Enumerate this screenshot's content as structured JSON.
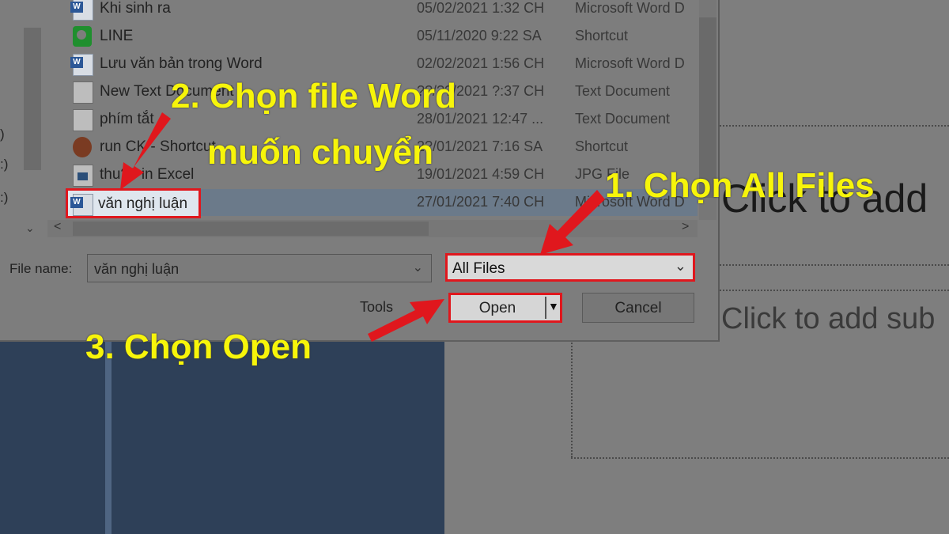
{
  "nav_pane": {
    "items": [
      ")",
      ":)",
      ":)"
    ]
  },
  "files": [
    {
      "name": "Khi sinh ra",
      "date": "05/02/2021 1:32 CH",
      "type": "Microsoft Word D",
      "icon": "word-doc-icon"
    },
    {
      "name": "LINE",
      "date": "05/11/2020 9:22 SA",
      "type": "Shortcut",
      "icon": "line-app-icon"
    },
    {
      "name": "Lưu văn bản trong Word",
      "date": "02/02/2021 1:56 CH",
      "type": "Microsoft Word D",
      "icon": "word-doc-icon"
    },
    {
      "name": "New Text Document",
      "date": "??/??/2021 ?:37 CH",
      "type": "Text Document",
      "icon": "text-doc-icon"
    },
    {
      "name": "phím tắt",
      "date": "28/01/2021 12:47 ...",
      "type": "Text Document",
      "icon": "text-doc-icon"
    },
    {
      "name": "run CK - Shortcut",
      "date": "2?/01/2021 7:16 SA",
      "type": "Shortcut",
      "icon": "shortcut-game-icon"
    },
    {
      "name": "thu?? in Excel",
      "date": "19/01/2021 4:59 CH",
      "type": "JPG File",
      "icon": "jpg-file-icon"
    },
    {
      "name": "văn nghị luận",
      "date": "27/01/2021 7:40 CH",
      "type": "Microsoft Word D",
      "icon": "word-doc-icon",
      "selected": true
    }
  ],
  "footer": {
    "file_name_label": "File name:",
    "file_name_value": "văn nghị luận",
    "file_type_value": "All Files",
    "tools_label": "Tools",
    "open_label": "Open",
    "cancel_label": "Cancel"
  },
  "background": {
    "title_placeholder": "Click to add",
    "subtitle_placeholder": "Click to add sub"
  },
  "annotations": {
    "step1": "1. Chọn All Files",
    "step2_line1": "2. Chọn file Word",
    "step2_line2": "muốn chuyển",
    "step3": "3. Chọn Open",
    "arrow_color": "#e0171d",
    "text_color": "#f7f50a"
  }
}
